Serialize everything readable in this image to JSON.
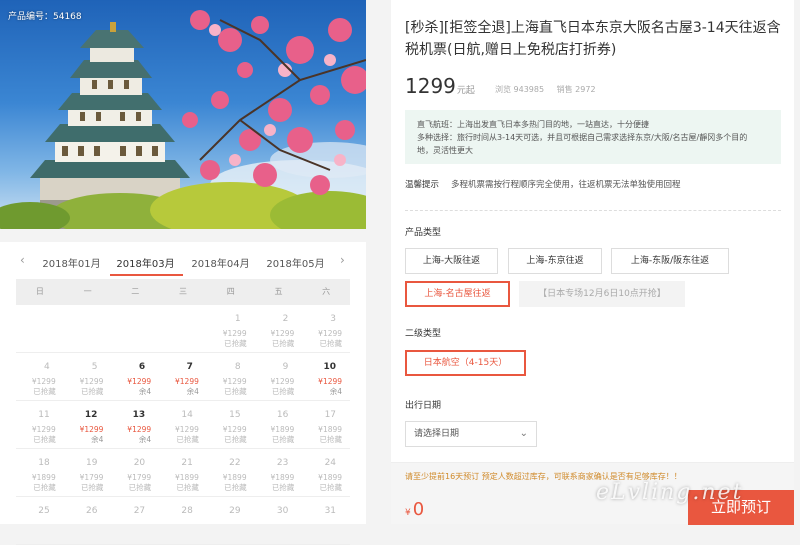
{
  "hero": {
    "product_code": "产品编号：54168",
    "image_alt": "osaka-castle-photo"
  },
  "calendar": {
    "prev_icon": "chevron-left-icon",
    "next_icon": "chevron-right-icon",
    "months": [
      "2018年01月",
      "2018年03月",
      "2018年04月",
      "2018年05月"
    ],
    "active_month_index": 1,
    "weekdays": [
      "日",
      "一",
      "二",
      "三",
      "四",
      "五",
      "六"
    ],
    "rows": [
      [
        {
          "d": "",
          "p": "",
          "s": "",
          "a": false
        },
        {
          "d": "",
          "p": "",
          "s": "",
          "a": false
        },
        {
          "d": "",
          "p": "",
          "s": "",
          "a": false
        },
        {
          "d": "",
          "p": "",
          "s": "",
          "a": false
        },
        {
          "d": "1",
          "p": "¥1299",
          "s": "已抢藏",
          "a": false
        },
        {
          "d": "2",
          "p": "¥1299",
          "s": "已抢藏",
          "a": false
        },
        {
          "d": "3",
          "p": "¥1299",
          "s": "已抢藏",
          "a": false
        }
      ],
      [
        {
          "d": "4",
          "p": "¥1299",
          "s": "已抢藏",
          "a": false
        },
        {
          "d": "5",
          "p": "¥1299",
          "s": "已抢藏",
          "a": false
        },
        {
          "d": "6",
          "p": "¥1299",
          "s": "余4",
          "a": true
        },
        {
          "d": "7",
          "p": "¥1299",
          "s": "余4",
          "a": true
        },
        {
          "d": "8",
          "p": "¥1299",
          "s": "已抢藏",
          "a": false
        },
        {
          "d": "9",
          "p": "¥1299",
          "s": "已抢藏",
          "a": false
        },
        {
          "d": "10",
          "p": "¥1299",
          "s": "余4",
          "a": true
        }
      ],
      [
        {
          "d": "11",
          "p": "¥1299",
          "s": "已抢藏",
          "a": false
        },
        {
          "d": "12",
          "p": "¥1299",
          "s": "余4",
          "a": true
        },
        {
          "d": "13",
          "p": "¥1299",
          "s": "余4",
          "a": true
        },
        {
          "d": "14",
          "p": "¥1299",
          "s": "已抢藏",
          "a": false
        },
        {
          "d": "15",
          "p": "¥1299",
          "s": "已抢藏",
          "a": false
        },
        {
          "d": "16",
          "p": "¥1899",
          "s": "已抢藏",
          "a": false
        },
        {
          "d": "17",
          "p": "¥1899",
          "s": "已抢藏",
          "a": false
        }
      ],
      [
        {
          "d": "18",
          "p": "¥1899",
          "s": "已抢藏",
          "a": false
        },
        {
          "d": "19",
          "p": "¥1799",
          "s": "已抢藏",
          "a": false
        },
        {
          "d": "20",
          "p": "¥1799",
          "s": "已抢藏",
          "a": false
        },
        {
          "d": "21",
          "p": "¥1899",
          "s": "已抢藏",
          "a": false
        },
        {
          "d": "22",
          "p": "¥1899",
          "s": "已抢藏",
          "a": false
        },
        {
          "d": "23",
          "p": "¥1899",
          "s": "已抢藏",
          "a": false
        },
        {
          "d": "24",
          "p": "¥1899",
          "s": "已抢藏",
          "a": false
        }
      ],
      [
        {
          "d": "25",
          "p": "",
          "s": "",
          "a": false
        },
        {
          "d": "26",
          "p": "",
          "s": "",
          "a": false
        },
        {
          "d": "27",
          "p": "",
          "s": "",
          "a": false
        },
        {
          "d": "28",
          "p": "",
          "s": "",
          "a": false
        },
        {
          "d": "29",
          "p": "",
          "s": "",
          "a": false
        },
        {
          "d": "30",
          "p": "",
          "s": "",
          "a": false
        },
        {
          "d": "31",
          "p": "",
          "s": "",
          "a": false
        }
      ]
    ]
  },
  "product": {
    "title": "[秒杀][拒签全退]上海直飞日本东京大阪名古屋3-14天往返含税机票(日航,赠日上免税店打折券)",
    "price": "1299",
    "price_suffix": "元起",
    "views": "浏览 943985",
    "sales": "销售 2972",
    "notice_line1": "直飞航班：上海出发直飞日本多热门目的地，一站直达，十分便捷",
    "notice_line2": "多种选择：旅行时间从3-14天可选，并且可根据自己需求选择东京/大阪/名古屋/靜冈多个目的",
    "notice_line3": "地，灵活性更大",
    "tips_label": "温馨提示",
    "tips_text": "多程机票需按行程顺序完全使用，往返机票无法单独使用回程"
  },
  "options": {
    "type_label": "产品类型",
    "types": [
      "上海-大阪往返",
      "上海-东京往返",
      "上海-东阪/阪东往返",
      "上海-名古屋往返"
    ],
    "disabled_type": "【日本专场12月6日10点开抢】",
    "sub_label": "二级类型",
    "sub_type": "日本航空（4-15天）",
    "date_label": "出行日期",
    "date_placeholder": "请选择日期"
  },
  "footer": {
    "warning": "请至少提前16天预订 预定人数超过库存，可联系商家确认是否有足够库存！！",
    "currency": "¥",
    "total": "0",
    "book_label": "立即预订",
    "watermark": "eLvling.net"
  },
  "colors": {
    "accent": "#e9573f",
    "notice_bg": "#edf6f2"
  }
}
